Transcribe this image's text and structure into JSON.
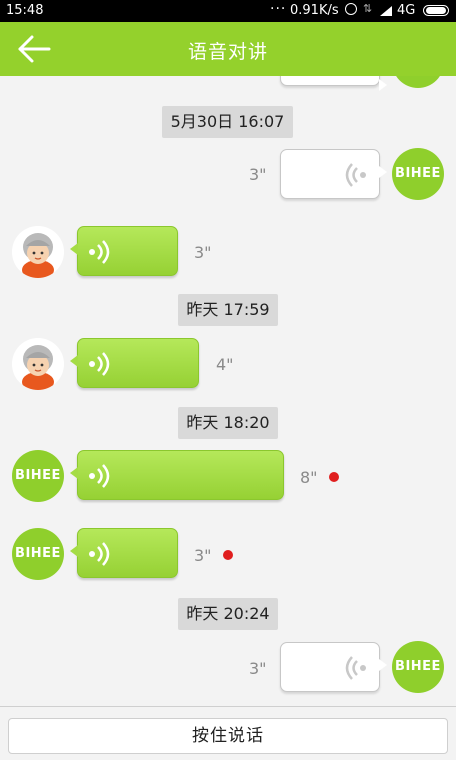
{
  "status_bar": {
    "time": "15:48",
    "dots": "···",
    "speed": "0.91K/s",
    "network": "4G"
  },
  "header": {
    "title": "语音对讲",
    "back_icon": "back-arrow-icon"
  },
  "messages": [
    {
      "type": "timestamp",
      "text": "5月30日 16:07"
    },
    {
      "type": "voice",
      "side": "right",
      "duration": "3\"",
      "unread": false,
      "avatar": "BIHEE"
    },
    {
      "type": "voice",
      "side": "left",
      "duration": "3\"",
      "unread": false,
      "avatar": "grandma"
    },
    {
      "type": "timestamp",
      "text": "昨天 17:59"
    },
    {
      "type": "voice",
      "side": "left",
      "duration": "4\"",
      "unread": false,
      "avatar": "grandma"
    },
    {
      "type": "timestamp",
      "text": "昨天 18:20"
    },
    {
      "type": "voice",
      "side": "left",
      "duration": "8\"",
      "unread": true,
      "avatar": "BIHEE"
    },
    {
      "type": "voice",
      "side": "left",
      "duration": "3\"",
      "unread": true,
      "avatar": "BIHEE"
    },
    {
      "type": "timestamp",
      "text": "昨天 20:24"
    },
    {
      "type": "voice",
      "side": "right",
      "duration": "3\"",
      "unread": false,
      "avatar": "BIHEE"
    }
  ],
  "bihee_label": "BIHEE",
  "footer": {
    "talk_label": "按住说话"
  },
  "colors": {
    "accent": "#94d12c",
    "bubble_green": "#a5dc45",
    "unread": "#e01e1e"
  }
}
